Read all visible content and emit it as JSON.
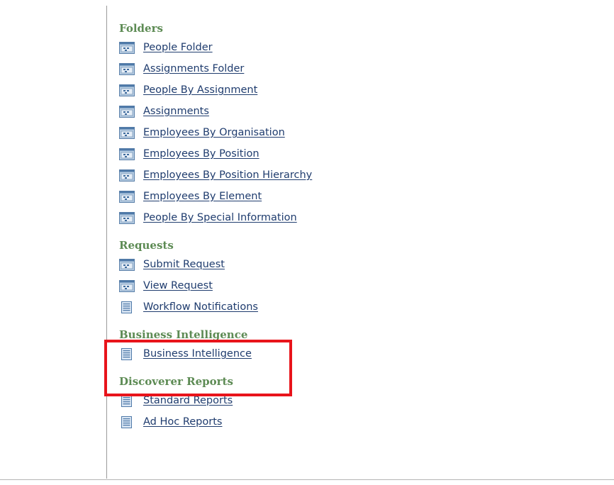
{
  "sections": [
    {
      "title": "Folders",
      "items": [
        {
          "label": "People Folder",
          "icon": "folder-icon"
        },
        {
          "label": "Assignments Folder",
          "icon": "folder-icon"
        },
        {
          "label": "People By Assignment",
          "icon": "folder-icon"
        },
        {
          "label": "Assignments",
          "icon": "folder-icon"
        },
        {
          "label": "Employees By Organisation",
          "icon": "folder-icon"
        },
        {
          "label": "Employees By Position",
          "icon": "folder-icon"
        },
        {
          "label": "Employees By Position Hierarchy",
          "icon": "folder-icon"
        },
        {
          "label": "Employees By Element",
          "icon": "folder-icon"
        },
        {
          "label": "People By Special Information",
          "icon": "folder-icon"
        }
      ]
    },
    {
      "title": "Requests",
      "items": [
        {
          "label": "Submit Request",
          "icon": "folder-icon"
        },
        {
          "label": "View Request",
          "icon": "folder-icon"
        },
        {
          "label": "Workflow Notifications",
          "icon": "document-icon"
        }
      ]
    },
    {
      "title": "Business Intelligence",
      "items": [
        {
          "label": "Business Intelligence",
          "icon": "document-icon"
        }
      ]
    },
    {
      "title": "Discoverer Reports",
      "items": [
        {
          "label": "Standard Reports",
          "icon": "document-icon"
        },
        {
          "label": "Ad Hoc Reports",
          "icon": "document-icon"
        }
      ]
    }
  ],
  "colors": {
    "section_title": "#5d8b54",
    "link": "#1f3c6e",
    "highlight_border": "#e8141b"
  }
}
